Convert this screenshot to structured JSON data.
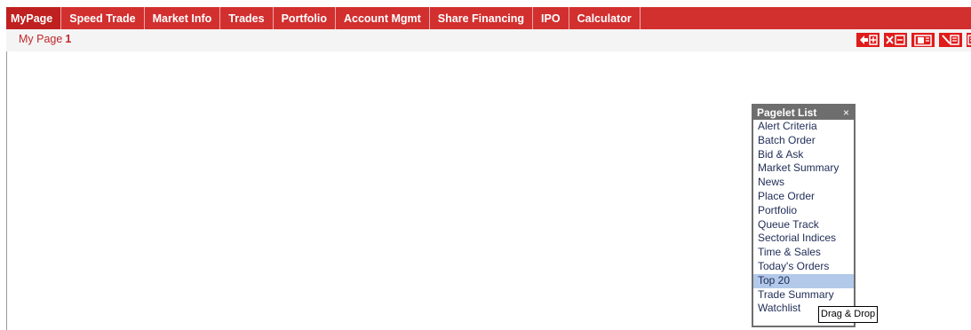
{
  "nav": {
    "items": [
      {
        "label": "MyPage",
        "active": true
      },
      {
        "label": "Speed Trade"
      },
      {
        "label": "Market Info"
      },
      {
        "label": "Trades"
      },
      {
        "label": "Portfolio"
      },
      {
        "label": "Account Mgmt"
      },
      {
        "label": "Share Financing"
      },
      {
        "label": "IPO"
      },
      {
        "label": "Calculator"
      }
    ],
    "bg_color": "#d22f2f"
  },
  "subheader": {
    "title_label": "My Page",
    "page_number": "1",
    "tool_icons": [
      "add-pagelet-icon",
      "remove-pagelet-icon",
      "save-layout-icon",
      "edit-layout-icon",
      "more-icon"
    ]
  },
  "pagelet_panel": {
    "title": "Pagelet List",
    "close_glyph": "×",
    "items": [
      {
        "label": "Alert Criteria"
      },
      {
        "label": "Batch Order"
      },
      {
        "label": "Bid & Ask"
      },
      {
        "label": "Market Summary"
      },
      {
        "label": "News"
      },
      {
        "label": "Place Order"
      },
      {
        "label": "Portfolio"
      },
      {
        "label": "Queue Track"
      },
      {
        "label": "Sectorial Indices"
      },
      {
        "label": "Time & Sales"
      },
      {
        "label": "Today's Orders"
      },
      {
        "label": "Top 20",
        "selected": true
      },
      {
        "label": "Trade Summary"
      },
      {
        "label": "Watchlist"
      }
    ]
  },
  "tooltip": {
    "text": "Drag & Drop"
  },
  "colors": {
    "accent": "#d22f2f",
    "title_red": "#c0282d",
    "selection": "#b3c9ea",
    "panel_border": "#6e6e6e"
  }
}
